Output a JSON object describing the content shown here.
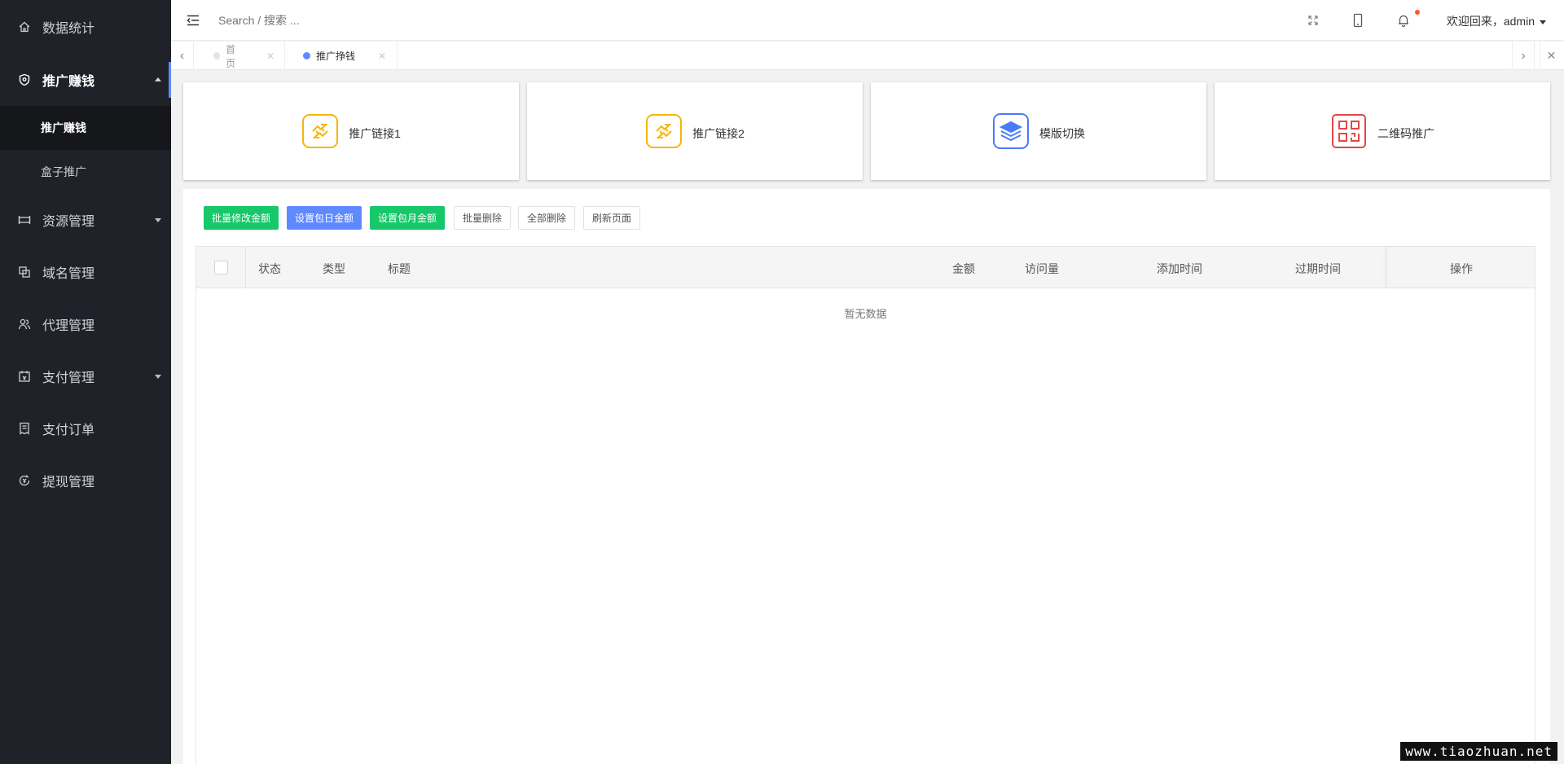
{
  "sidebar": {
    "items": [
      {
        "label": "数据统计",
        "icon": "home-icon"
      },
      {
        "label": "推广赚钱",
        "icon": "shield-icon",
        "expanded": true,
        "children": [
          {
            "label": "推广赚钱"
          },
          {
            "label": "盒子推广"
          }
        ]
      },
      {
        "label": "资源管理",
        "icon": "server-icon"
      },
      {
        "label": "域名管理",
        "icon": "copy-icon"
      },
      {
        "label": "代理管理",
        "icon": "users-icon"
      },
      {
        "label": "支付管理",
        "icon": "wallet-icon"
      },
      {
        "label": "支付订单",
        "icon": "receipt-icon"
      },
      {
        "label": "提现管理",
        "icon": "withdraw-icon"
      }
    ]
  },
  "header": {
    "search_placeholder": "Search / 搜索 ...",
    "user_greeting": "欢迎回来，admin"
  },
  "tabs": [
    {
      "label": "首页",
      "active": false
    },
    {
      "label": "推广挣钱",
      "active": true
    }
  ],
  "cards": [
    {
      "label": "推广链接1",
      "icon": "link-icon",
      "color": "#f5b50c"
    },
    {
      "label": "推广链接2",
      "icon": "link-icon",
      "color": "#f5b50c"
    },
    {
      "label": "模版切换",
      "icon": "layers-icon",
      "color": "#4a7bf7"
    },
    {
      "label": "二维码推广",
      "icon": "qrcode-icon",
      "color": "#e04848"
    }
  ],
  "toolbar": {
    "batch_edit": "批量修改金额",
    "set_daily": "设置包日金额",
    "set_monthly": "设置包月金额",
    "batch_delete": "批量删除",
    "delete_all": "全部删除",
    "refresh": "刷新页面"
  },
  "table": {
    "columns": [
      "状态",
      "类型",
      "标题",
      "金额",
      "访问量",
      "添加时间",
      "过期时间",
      "操作"
    ],
    "empty_text": "暂无数据"
  },
  "watermark": "www.tiaozhuan.net",
  "colors": {
    "sidebar_bg": "#20222a",
    "accent": "#5f8aff",
    "green": "#16c869"
  }
}
